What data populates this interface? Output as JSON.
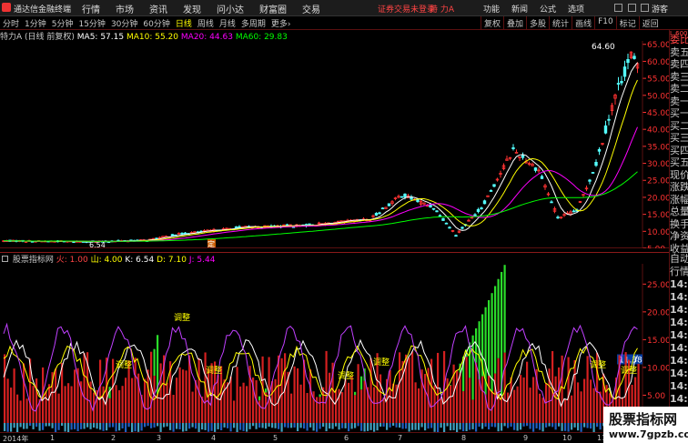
{
  "app": {
    "brand": "通达信金融终端"
  },
  "menu": [
    "行情",
    "市场",
    "资讯",
    "发现",
    "问小达",
    "财富圈",
    "交易"
  ],
  "notice": "证券交易未登录",
  "notice_stock": "特 力A",
  "right_menu": [
    "功能",
    "新闻",
    "公式",
    "选项"
  ],
  "guest": "游客",
  "periods": [
    "分时",
    "1分钟",
    "5分钟",
    "15分钟",
    "30分钟",
    "60分钟",
    "日线",
    "周线",
    "月线",
    "多周期",
    "更多"
  ],
  "period_arrow": "›",
  "active_period": "日线",
  "toolbar": [
    "复权",
    "叠加",
    "多股",
    "统计",
    "画线",
    "F10",
    "标记",
    "返回"
  ],
  "main_header": {
    "stock": "特力A (日线 前复权)",
    "ma5_label": "MA5: 57.15",
    "ma10_label": "MA10: 55.20",
    "ma20_label": "MA20: 44.63",
    "ma60_label": "MA60: 29.83"
  },
  "colors": {
    "ma5": "#ffffff",
    "ma10": "#ffff00",
    "ma20": "#ff00ff",
    "ma60": "#00ff00",
    "up": "#ff3232",
    "down": "#54ffff",
    "axis": "#ff3232"
  },
  "price_axis": [
    "65.00",
    "60.00",
    "55.00",
    "50.00",
    "45.00",
    "40.00",
    "35.00",
    "30.00",
    "25.00",
    "20.00",
    "15.00",
    "10.00",
    "5.00"
  ],
  "high_label": "64.60",
  "low_label": "6.54",
  "marker_label": "定",
  "right_panel_tag": "L 600",
  "right_panel": [
    "委比",
    "卖五",
    "卖四",
    "卖三",
    "卖二",
    "卖一",
    "买一",
    "买二",
    "买三",
    "买四",
    "买五",
    "现价",
    "涨跌",
    "涨幅",
    "总量",
    "换手",
    "净资",
    "收益"
  ],
  "sub_header": {
    "name": "股票指标网",
    "fire": "火: 1.00",
    "mountain": "山: 4.00",
    "k": "K: 6.54",
    "d": "D: 7.10",
    "j": "J: 5.44"
  },
  "sub_axis": [
    "25.00",
    "20.00",
    "15.00",
    "10.00",
    "5.00"
  ],
  "sub_value_box": "11.38",
  "adjust_label": "调整",
  "peak_label": "调整",
  "right_panel2": [
    "自动",
    "行情",
    "14:50",
    "14:50",
    "14:50",
    "14:50",
    "14:50",
    "14:50",
    "14:50",
    "14:50",
    "14:50",
    "14:50",
    "14:50",
    "14:50",
    "14:5"
  ],
  "time_axis": [
    "2014年",
    "1",
    "2",
    "3",
    "4",
    "5",
    "6",
    "7",
    "8",
    "9",
    "10",
    "11"
  ],
  "watermark": {
    "line1": "股票指标网",
    "line2": "www.7gpzb.com"
  }
}
